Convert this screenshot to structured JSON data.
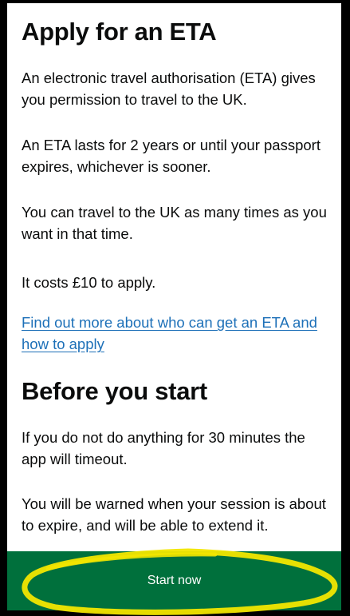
{
  "page": {
    "title": "Apply for an ETA",
    "intro_1": "An electronic travel authorisation (ETA) gives you permission to travel to the UK.",
    "intro_2": "An ETA lasts for 2 years or until your passport expires, whichever is sooner.",
    "intro_3": "You can travel to the UK as many times as you want in that time.",
    "intro_4": "It costs £10 to apply.",
    "link_text": "Find out more about who can get an ETA and how to apply",
    "section_title": "Before you start",
    "timeout_text": "If you do not do anything for 30 minutes the app will timeout.",
    "warning_text": "You will be warned when your session is about to expire, and will be able to extend it."
  },
  "actions": {
    "start_label": "Start now"
  },
  "colors": {
    "text": "#0b0c0c",
    "link": "#1d70b8",
    "button_bg": "#00703c",
    "button_text": "#ffffff",
    "annotation_highlight": "#f2e600"
  },
  "annotations": {
    "highlight_icon": "hand-drawn-highlight-circle"
  }
}
